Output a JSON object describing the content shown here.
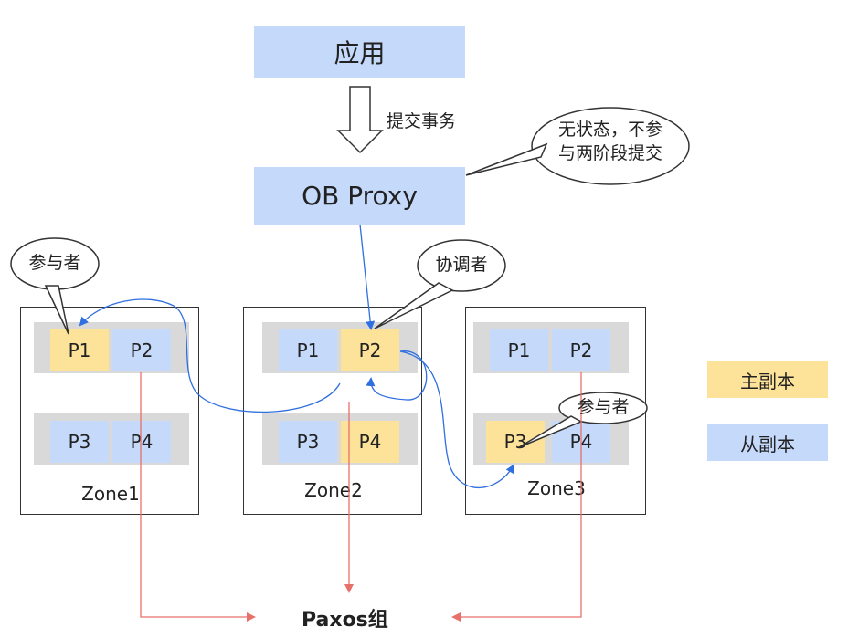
{
  "app_box": {
    "label": "应用"
  },
  "submit_label": "提交事务",
  "proxy_box": {
    "label": "OB Proxy"
  },
  "proxy_note": {
    "line1": "无状态，不参",
    "line2": "与两阶段提交"
  },
  "bubbles": {
    "participant_left": "参与者",
    "coordinator": "协调者",
    "participant_right": "参与者"
  },
  "zones": [
    {
      "name": "Zone1",
      "rows": [
        [
          {
            "label": "P1",
            "role": "leader"
          },
          {
            "label": "P2",
            "role": "follower"
          }
        ],
        [
          {
            "label": "P3",
            "role": "follower"
          },
          {
            "label": "P4",
            "role": "follower"
          }
        ]
      ]
    },
    {
      "name": "Zone2",
      "rows": [
        [
          {
            "label": "P1",
            "role": "follower"
          },
          {
            "label": "P2",
            "role": "leader"
          }
        ],
        [
          {
            "label": "P3",
            "role": "follower"
          },
          {
            "label": "P4",
            "role": "leader"
          }
        ]
      ]
    },
    {
      "name": "Zone3",
      "rows": [
        [
          {
            "label": "P1",
            "role": "follower"
          },
          {
            "label": "P2",
            "role": "follower"
          }
        ],
        [
          {
            "label": "P3",
            "role": "leader"
          },
          {
            "label": "P4",
            "role": "follower"
          }
        ]
      ]
    }
  ],
  "legend": {
    "leader": "主副本",
    "follower": "从副本"
  },
  "paxos_label": "Paxos组",
  "colors": {
    "follower": "#c5d9fb",
    "leader": "#fde39a",
    "row_bg": "#d9d9d9",
    "blue_line": "#2f6fdf",
    "red_line": "#e8706a"
  }
}
